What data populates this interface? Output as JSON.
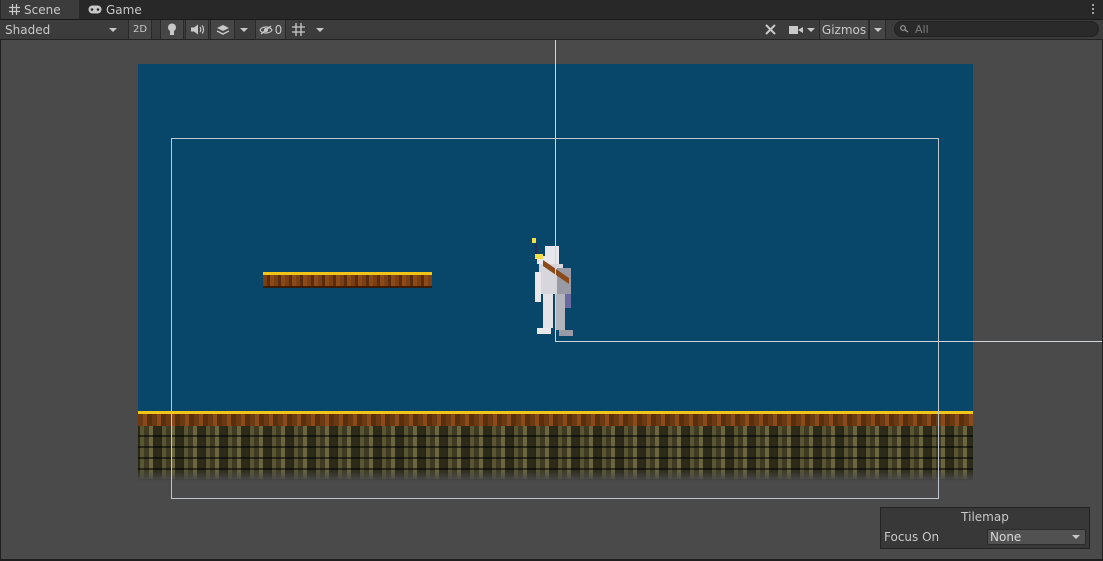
{
  "tabs": [
    {
      "label": "Scene",
      "icon": "grid-icon",
      "active": true
    },
    {
      "label": "Game",
      "icon": "gamepad-icon",
      "active": false
    }
  ],
  "toolbar": {
    "shading_mode": "Shaded",
    "mode_2d_label": "2D",
    "hidden_count": "0",
    "gizmos_label": "Gizmos",
    "search_placeholder": "All"
  },
  "overlay": {
    "title": "Tilemap",
    "focus_label": "Focus On",
    "focus_value": "None"
  },
  "colors": {
    "scene_background": "#4a4a4a",
    "game_sky": "#08466a",
    "platform_top": "#f0c419"
  }
}
